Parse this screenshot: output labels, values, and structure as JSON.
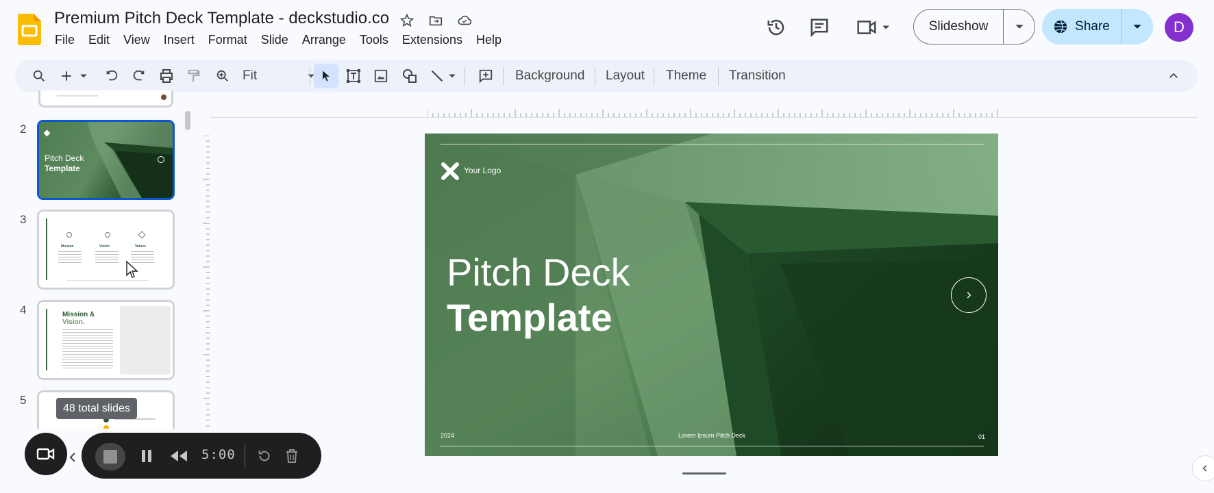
{
  "app": {
    "title": "Premium Pitch Deck Template - deckstudio.co",
    "menu": [
      "File",
      "Edit",
      "View",
      "Insert",
      "Format",
      "Slide",
      "Arrange",
      "Tools",
      "Extensions",
      "Help"
    ],
    "brand_color": "#fbbc04"
  },
  "header": {
    "slideshow_label": "Slideshow",
    "share_label": "Share",
    "avatar_letter": "D"
  },
  "toolbar": {
    "zoom_value": "Fit",
    "background_label": "Background",
    "layout_label": "Layout",
    "theme_label": "Theme",
    "transition_label": "Transition"
  },
  "filmstrip": {
    "slide_numbers": [
      "2",
      "3",
      "4",
      "5"
    ],
    "selected_slide": "2",
    "tooltip": "48 total slides"
  },
  "slide": {
    "logo_text": "Your Logo",
    "title_line1": "Pitch Deck",
    "title_line2": "Template",
    "footer_year": "2024",
    "footer_center": "Lorem Ipsum Pitch Deck",
    "footer_page": "01",
    "background_color": "#4e7a51"
  },
  "thumb2": {
    "title_line1": "Pitch Deck",
    "title_line2": "Template"
  },
  "thumb3": {
    "col1": "Mission",
    "col2": "Vision",
    "col3": "Values"
  },
  "thumb4": {
    "title_line1": "Mission &",
    "title_line2": "Vision."
  },
  "recorder": {
    "timer": "5:00"
  }
}
